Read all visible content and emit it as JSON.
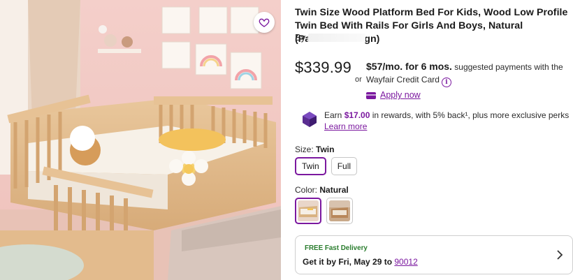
{
  "product": {
    "title": "Twin Size Wood Platform Bed For Kids, Wood Low Profile Twin Bed With Rails For Girls And Boys, Natural (Patented Design)",
    "by_label": "By"
  },
  "pricing": {
    "price": "$339.99",
    "or_label": "or",
    "monthly": "$57/mo. for 6 mos.",
    "suggested_text": "suggested payments with the Wayfair Credit Card",
    "apply_label": "Apply now"
  },
  "rewards": {
    "prefix": "Earn",
    "amount": "$17.00",
    "suffix": "in rewards, with 5% back¹, plus more exclusive perks",
    "learn_more": "Learn more"
  },
  "size": {
    "label": "Size:",
    "selected": "Twin",
    "options": [
      "Twin",
      "Full"
    ]
  },
  "color": {
    "label": "Color:",
    "selected": "Natural"
  },
  "delivery": {
    "badge": "FREE Fast Delivery",
    "get_it_by": "Get it by Fri, May 29 to",
    "zip": "90012"
  },
  "icons": {
    "favorite": "heart-icon",
    "info": "info-icon",
    "card": "credit-card-icon",
    "rewards": "gem-icon",
    "delivery_arrow": "chevron-right-icon"
  },
  "colors": {
    "accent": "#7b189f",
    "delivery_green": "#2a7d2e"
  }
}
